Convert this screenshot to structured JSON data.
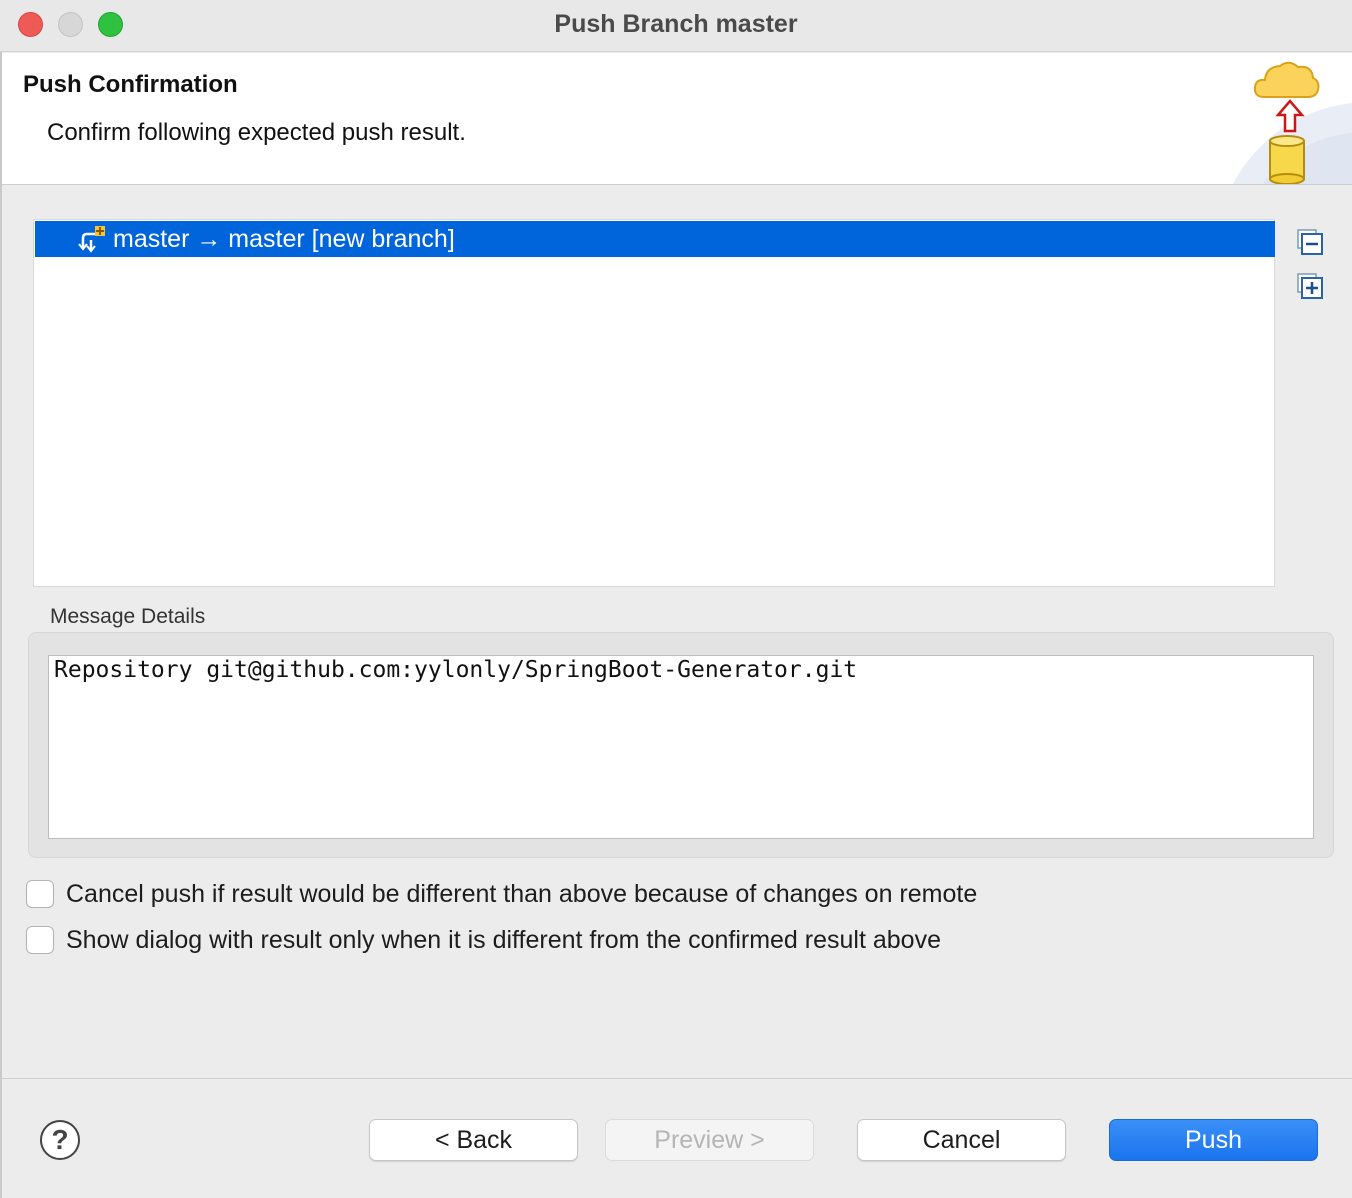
{
  "window": {
    "title": "Push Branch master"
  },
  "header": {
    "title": "Push Confirmation",
    "description": "Confirm following expected push result."
  },
  "tree": {
    "rows": [
      {
        "label": "master → master [new branch]",
        "selected": true
      }
    ]
  },
  "side_buttons": {
    "collapse_icon": "collapse-all-icon",
    "expand_icon": "expand-all-icon"
  },
  "details": {
    "label": "Message Details",
    "text": "Repository git@github.com:yylonly/SpringBoot-Generator.git"
  },
  "options": [
    {
      "label": "Cancel push if result would be different than above because of changes on remote",
      "checked": false
    },
    {
      "label": "Show dialog with result only when it is different from the confirmed result above",
      "checked": false
    }
  ],
  "footer": {
    "help_label": "?",
    "back_label": "< Back",
    "preview_label": "Preview >",
    "cancel_label": "Cancel",
    "push_label": "Push"
  },
  "colors": {
    "selection": "#0065da",
    "primary_button": "#1a74ee"
  }
}
